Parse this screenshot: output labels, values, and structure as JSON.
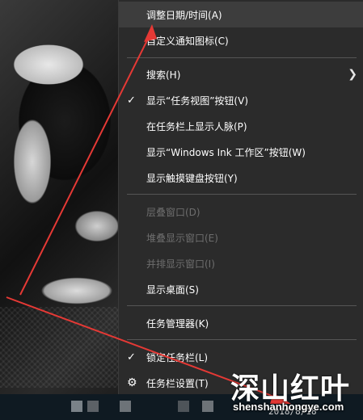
{
  "menu": {
    "items": [
      {
        "label": "调整日期/时间(A)"
      },
      {
        "label": "自定义通知图标(C)"
      },
      {
        "label": "搜索(H)",
        "submenu_icon": "chevron-right-icon"
      },
      {
        "label": "显示“任务视图”按钮(V)",
        "checked": true
      },
      {
        "label": "在任务栏上显示人脉(P)"
      },
      {
        "label": "显示“Windows Ink 工作区”按钮(W)"
      },
      {
        "label": "显示触摸键盘按钮(Y)"
      },
      {
        "label": "层叠窗口(D)",
        "disabled": true
      },
      {
        "label": "堆叠显示窗口(E)",
        "disabled": true
      },
      {
        "label": "并排显示窗口(I)",
        "disabled": true
      },
      {
        "label": "显示桌面(S)"
      },
      {
        "label": "任务管理器(K)"
      },
      {
        "label": "锁定任务栏(L)",
        "checked": true
      },
      {
        "label": "任务栏设置(T)",
        "icon": "gear-icon"
      }
    ]
  },
  "taskbar": {
    "clock_date": "2018/8/18"
  },
  "watermark": {
    "logo_text": "深山红叶",
    "url": "shenshanhongye.com"
  },
  "colors": {
    "menu_bg": "#2b2b2b",
    "annotation_arrow": "#e53935"
  }
}
